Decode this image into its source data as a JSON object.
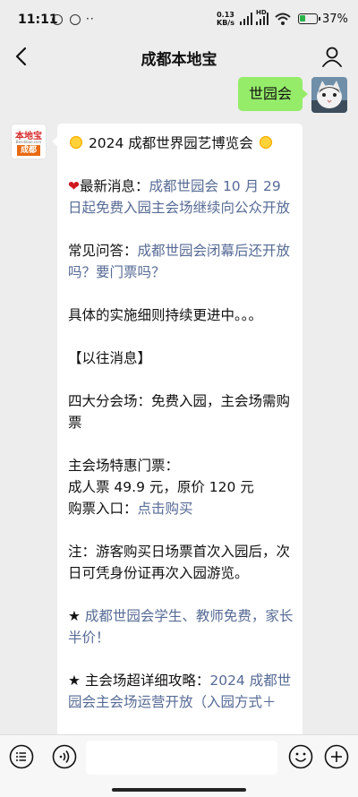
{
  "status_bar": {
    "time": "11:11",
    "net_speed_value": "0.13",
    "net_speed_unit": "KB/s",
    "hd_label": "HD",
    "battery_percent": "37%",
    "battery_level": 0.37
  },
  "header": {
    "title": "成都本地宝"
  },
  "chat": {
    "sent_message": "世园会",
    "bot_logo": {
      "top": "本地宝",
      "mid": "Bendibao.com",
      "bottom": "成都"
    },
    "reply": {
      "title": "2024 成都世界园艺博览会",
      "latest_label": "最新消息：",
      "latest_link": "成都世园会 10 月 29 日起免费入园主会场继续向公众开放",
      "faq_label": "常见问答：",
      "faq_link": "成都世园会闭幕后还开放吗？要门票吗？",
      "detail_text": "具体的实施细则持续更进中。。。",
      "past_header": "【以往消息】",
      "venues_text": "四大分会场：免费入园，主会场需购票",
      "discount_title": "主会场特惠门票：",
      "adult_ticket": "成人票 49.9 元，原价 120 元",
      "buy_label": "购票入口：",
      "buy_link": "点击购买",
      "note_text": "注：游客购买日场票首次入园后，次日可凭身份证再次入园游览。",
      "star_item_1": "成都世园会学生、教师免费，家长半价！",
      "star_item_2_label": "主会场超详细攻略：",
      "star_item_2_link": "2024 成都世园会主会场运营开放（入园方式＋"
    }
  },
  "colors": {
    "background": "#ededed",
    "sent_bubble": "#95ec69",
    "link": "#576b95",
    "heart": "#d0181f"
  }
}
